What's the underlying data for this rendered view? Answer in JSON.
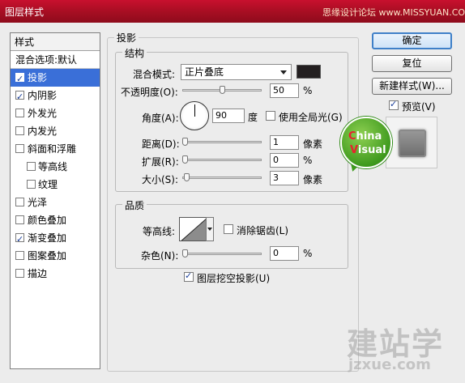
{
  "window": {
    "title": "图层样式",
    "watermark_text": "思缘设计论坛 www.MISSYUAN.COM"
  },
  "styles": {
    "header": "样式",
    "blend_label": "混合选项:默认",
    "items": [
      {
        "label": "投影",
        "checked": true,
        "selected": true,
        "sub": false
      },
      {
        "label": "内阴影",
        "checked": true,
        "selected": false,
        "sub": false
      },
      {
        "label": "外发光",
        "checked": false,
        "selected": false,
        "sub": false
      },
      {
        "label": "内发光",
        "checked": false,
        "selected": false,
        "sub": false
      },
      {
        "label": "斜面和浮雕",
        "checked": false,
        "selected": false,
        "sub": false
      },
      {
        "label": "等高线",
        "checked": false,
        "selected": false,
        "sub": true
      },
      {
        "label": "纹理",
        "checked": false,
        "selected": false,
        "sub": true
      },
      {
        "label": "光泽",
        "checked": false,
        "selected": false,
        "sub": false
      },
      {
        "label": "颜色叠加",
        "checked": false,
        "selected": false,
        "sub": false
      },
      {
        "label": "渐变叠加",
        "checked": true,
        "selected": false,
        "sub": false
      },
      {
        "label": "图案叠加",
        "checked": false,
        "selected": false,
        "sub": false
      },
      {
        "label": "描边",
        "checked": false,
        "selected": false,
        "sub": false
      }
    ]
  },
  "shadow": {
    "section_title": "投影",
    "structure": {
      "title": "结构",
      "blend_mode": {
        "label": "混合模式:",
        "value": "正片叠底",
        "color": "#231f20"
      },
      "opacity": {
        "label": "不透明度(O):",
        "value": "50",
        "unit": "%",
        "percent": 50
      },
      "angle": {
        "label": "角度(A):",
        "value": "90",
        "unit": "度",
        "degrees": 90,
        "global_light_label": "使用全局光(G)",
        "global_light": false
      },
      "distance": {
        "label": "距离(D):",
        "value": "1",
        "unit": "像素",
        "slider_fraction": 0.0
      },
      "spread": {
        "label": "扩展(R):",
        "value": "0",
        "unit": "%",
        "slider_fraction": 0.0
      },
      "size": {
        "label": "大小(S):",
        "value": "3",
        "unit": "像素",
        "slider_fraction": 0.02
      }
    },
    "quality": {
      "title": "品质",
      "contour_label": "等高线:",
      "anti_alias_label": "消除锯齿(L)",
      "anti_alias": false,
      "noise": {
        "label": "杂色(N):",
        "value": "0",
        "unit": "%",
        "slider_fraction": 0.0
      }
    },
    "knockout_label": "图层挖空投影(U)",
    "knockout": true
  },
  "buttons": {
    "ok": "确定",
    "reset": "复位",
    "new_style": "新建样式(W)...",
    "preview_label": "预览(V)",
    "preview": true
  },
  "badge": {
    "line1": "China",
    "line2": "Visual"
  },
  "watermark": {
    "big": "建站学",
    "small": "jzxue.com"
  }
}
